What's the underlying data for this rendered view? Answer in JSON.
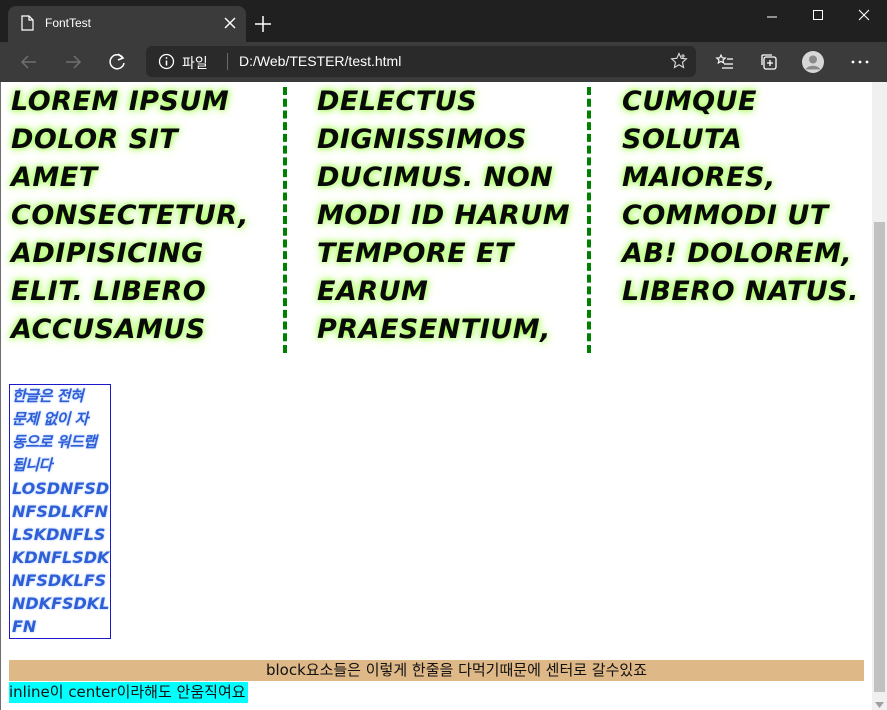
{
  "browser": {
    "tab_title": "FontTest",
    "address": {
      "scheme_label": "파일",
      "url": "D:/Web/TESTER/test.html"
    },
    "icons": {
      "back": "back-arrow-icon",
      "forward": "forward-arrow-icon",
      "refresh": "refresh-icon",
      "info": "info-icon",
      "favorite": "star-icon",
      "favorites_hub": "favorites-list-icon",
      "collections": "collections-icon",
      "profile": "profile-avatar-icon",
      "menu": "more-dots-icon"
    }
  },
  "page": {
    "columns": [
      [
        "Lorem ipsum",
        "dolor sit",
        "amet",
        "consectetur,",
        "adipisicing",
        "elit. Libero",
        "accusamus"
      ],
      [
        "delectus",
        "dignissimos",
        "ducimus. Non",
        "modi id harum",
        "tempore et",
        "earum",
        "praesentium,"
      ],
      [
        "cumque",
        "soluta",
        "maiores,",
        "commodi ut",
        "ab! Dolorem,",
        "libero natus."
      ]
    ],
    "narrow_box_lines": [
      "한글은 전혀",
      "문제 없이 자",
      "동으로 워드랩",
      "됩니다",
      "losdnfsd",
      "nfsdlkfn",
      "lskdnfls",
      "kdnflsdk",
      "nfsdklfs",
      "ndkfsdkl",
      "fn"
    ],
    "block_text": "block요소들은 이렇게 한줄을 다먹기때문에 센터로 갈수있죠",
    "inline_text": "inline이 center이라해도 안움직여요"
  },
  "colors": {
    "column_rule": "#008000",
    "text_glow": "#9cff4a",
    "narrow_text": "#2f5fd6",
    "block_bg": "#deb887",
    "inline_bg": "#00ffff"
  }
}
